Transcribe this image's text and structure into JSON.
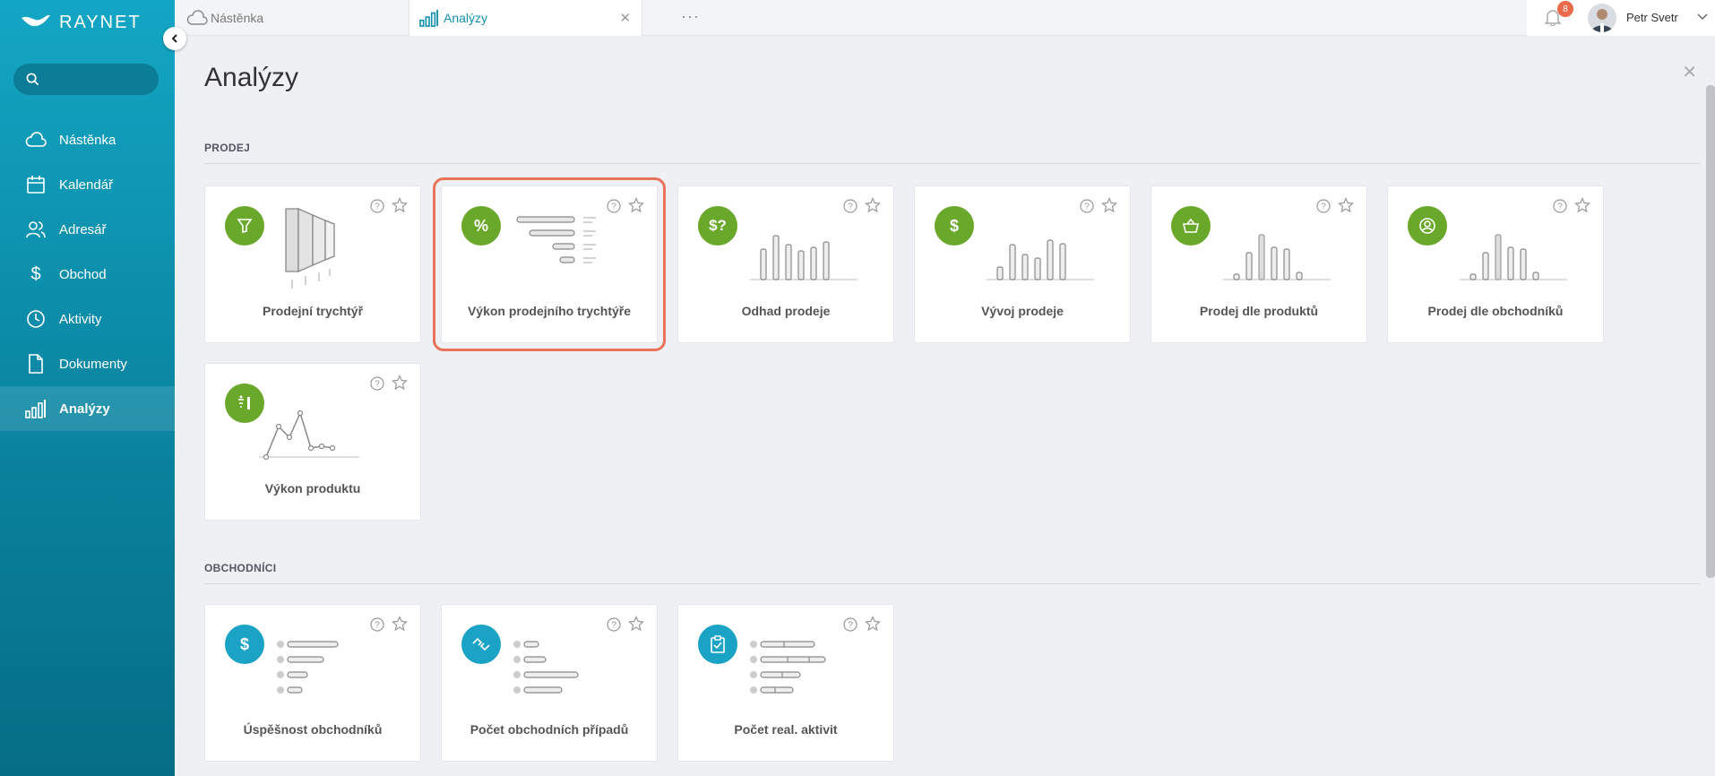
{
  "app": {
    "logo_text": "RAYNET"
  },
  "search": {
    "placeholder": ""
  },
  "sidebar": {
    "items": [
      {
        "label": "Nástěnka",
        "icon": "cloud-icon"
      },
      {
        "label": "Kalendář",
        "icon": "calendar-icon"
      },
      {
        "label": "Adresář",
        "icon": "contacts-icon"
      },
      {
        "label": "Obchod",
        "icon": "dollar-icon"
      },
      {
        "label": "Aktivity",
        "icon": "clock-icon"
      },
      {
        "label": "Dokumenty",
        "icon": "document-icon"
      },
      {
        "label": "Analýzy",
        "icon": "bar-chart-icon",
        "active": true
      }
    ]
  },
  "tabs": [
    {
      "label": "Nástěnka",
      "icon": "cloud-icon"
    },
    {
      "label": "Analýzy",
      "icon": "bar-chart-icon",
      "active": true
    }
  ],
  "user": {
    "name": "Petr Svetr",
    "notifications": "8"
  },
  "page": {
    "title": "Analýzy"
  },
  "sections": [
    {
      "title": "PRODEJ",
      "cards": [
        {
          "label": "Prodejní trychtýř",
          "icon": "filter-icon"
        },
        {
          "label": "Výkon prodejního trychtýře",
          "icon": "percent-icon",
          "highlighted": true
        },
        {
          "label": "Odhad prodeje",
          "icon": "dollar-question-icon"
        },
        {
          "label": "Vývoj prodeje",
          "icon": "dollar-icon"
        },
        {
          "label": "Prodej dle produktů",
          "icon": "basket-icon"
        },
        {
          "label": "Prodej dle obchodníků",
          "icon": "user-circle-icon"
        },
        {
          "label": "Výkon produktu",
          "icon": "product-chart-icon"
        }
      ]
    },
    {
      "title": "OBCHODNÍCI",
      "cards": [
        {
          "label": "Úspěšnost obchodníků",
          "icon": "dollar-icon"
        },
        {
          "label": "Počet obchodních případů",
          "icon": "handshake-icon"
        },
        {
          "label": "Počet real. aktivit",
          "icon": "clipboard-check-icon"
        }
      ]
    }
  ],
  "colors": {
    "sidebar_top": "#13a6c4",
    "sidebar_bottom": "#066d86",
    "green": "#6aa82c",
    "blue": "#1aa3c5",
    "highlight": "#e8725a"
  }
}
